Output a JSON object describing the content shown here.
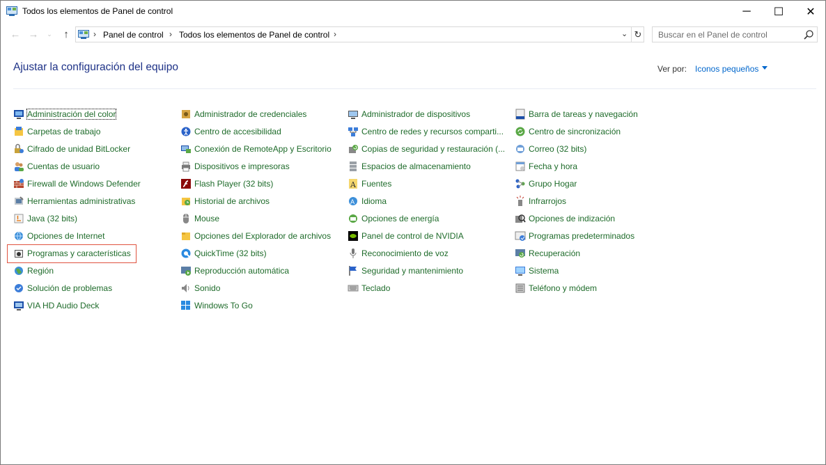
{
  "window": {
    "title": "Todos los elementos de Panel de control",
    "minimize_label": "─",
    "maximize_label": "☐",
    "close_label": "✕"
  },
  "navigation": {
    "back_icon": "←",
    "forward_icon": "→",
    "recent_icon": "⌄",
    "up_icon": "↑"
  },
  "address_bar": {
    "separator": "›",
    "crumbs": [
      "Panel de control",
      "Todos los elementos de Panel de control"
    ],
    "dropdown_icon": "⌄",
    "refresh_icon": "↻"
  },
  "search": {
    "placeholder": "Buscar en el Panel de control"
  },
  "header": {
    "title": "Ajustar la configuración del equipo",
    "view_by_label": "Ver por:",
    "view_by_value": "Iconos pequeños"
  },
  "columns": [
    [
      {
        "label": "Administración del color",
        "icon": "color-monitor-icon"
      },
      {
        "label": "Carpetas de trabajo",
        "icon": "work-folders-icon"
      },
      {
        "label": "Cifrado de unidad BitLocker",
        "icon": "bitlocker-icon"
      },
      {
        "label": "Cuentas de usuario",
        "icon": "user-accounts-icon"
      },
      {
        "label": "Firewall de Windows Defender",
        "icon": "firewall-icon"
      },
      {
        "label": "Herramientas administrativas",
        "icon": "admin-tools-icon"
      },
      {
        "label": "Java (32 bits)",
        "icon": "java-icon"
      },
      {
        "label": "Opciones de Internet",
        "icon": "internet-options-icon"
      },
      {
        "label": "Programas y características",
        "icon": "programs-features-icon"
      },
      {
        "label": "Región",
        "icon": "region-icon"
      },
      {
        "label": "Solución de problemas",
        "icon": "troubleshooting-icon"
      },
      {
        "label": "VIA HD Audio Deck",
        "icon": "via-audio-icon"
      }
    ],
    [
      {
        "label": "Administrador de credenciales",
        "icon": "credential-manager-icon"
      },
      {
        "label": "Centro de accesibilidad",
        "icon": "accessibility-icon"
      },
      {
        "label": "Conexión de RemoteApp y Escritorio",
        "icon": "remoteapp-icon"
      },
      {
        "label": "Dispositivos e impresoras",
        "icon": "devices-printers-icon"
      },
      {
        "label": "Flash Player (32 bits)",
        "icon": "flash-player-icon"
      },
      {
        "label": "Historial de archivos",
        "icon": "file-history-icon"
      },
      {
        "label": "Mouse",
        "icon": "mouse-icon"
      },
      {
        "label": "Opciones del Explorador de archivos",
        "icon": "explorer-options-icon"
      },
      {
        "label": "QuickTime (32 bits)",
        "icon": "quicktime-icon"
      },
      {
        "label": "Reproducción automática",
        "icon": "autoplay-icon"
      },
      {
        "label": "Sonido",
        "icon": "sound-icon"
      },
      {
        "label": "Windows To Go",
        "icon": "windows-to-go-icon"
      }
    ],
    [
      {
        "label": "Administrador de dispositivos",
        "icon": "device-manager-icon"
      },
      {
        "label": "Centro de redes y recursos comparti...",
        "icon": "network-center-icon"
      },
      {
        "label": "Copias de seguridad y restauración (...",
        "icon": "backup-restore-icon"
      },
      {
        "label": "Espacios de almacenamiento",
        "icon": "storage-spaces-icon"
      },
      {
        "label": "Fuentes",
        "icon": "fonts-icon"
      },
      {
        "label": "Idioma",
        "icon": "language-icon"
      },
      {
        "label": "Opciones de energía",
        "icon": "power-options-icon"
      },
      {
        "label": "Panel de control de NVIDIA",
        "icon": "nvidia-icon"
      },
      {
        "label": "Reconocimiento de voz",
        "icon": "speech-recognition-icon"
      },
      {
        "label": "Seguridad y mantenimiento",
        "icon": "security-maintenance-icon"
      },
      {
        "label": "Teclado",
        "icon": "keyboard-icon"
      }
    ],
    [
      {
        "label": "Barra de tareas y navegación",
        "icon": "taskbar-icon"
      },
      {
        "label": "Centro de sincronización",
        "icon": "sync-center-icon"
      },
      {
        "label": "Correo (32 bits)",
        "icon": "mail-icon"
      },
      {
        "label": "Fecha y hora",
        "icon": "date-time-icon"
      },
      {
        "label": "Grupo Hogar",
        "icon": "homegroup-icon"
      },
      {
        "label": "Infrarrojos",
        "icon": "infrared-icon"
      },
      {
        "label": "Opciones de indización",
        "icon": "indexing-options-icon"
      },
      {
        "label": "Programas predeterminados",
        "icon": "default-programs-icon"
      },
      {
        "label": "Recuperación",
        "icon": "recovery-icon"
      },
      {
        "label": "Sistema",
        "icon": "system-icon"
      },
      {
        "label": "Teléfono y módem",
        "icon": "phone-modem-icon"
      }
    ]
  ],
  "colors": {
    "link_green": "#1e6b2a",
    "title_blue": "#1e3287",
    "accent_blue": "#0066cc",
    "highlight_red": "#e0533f"
  }
}
